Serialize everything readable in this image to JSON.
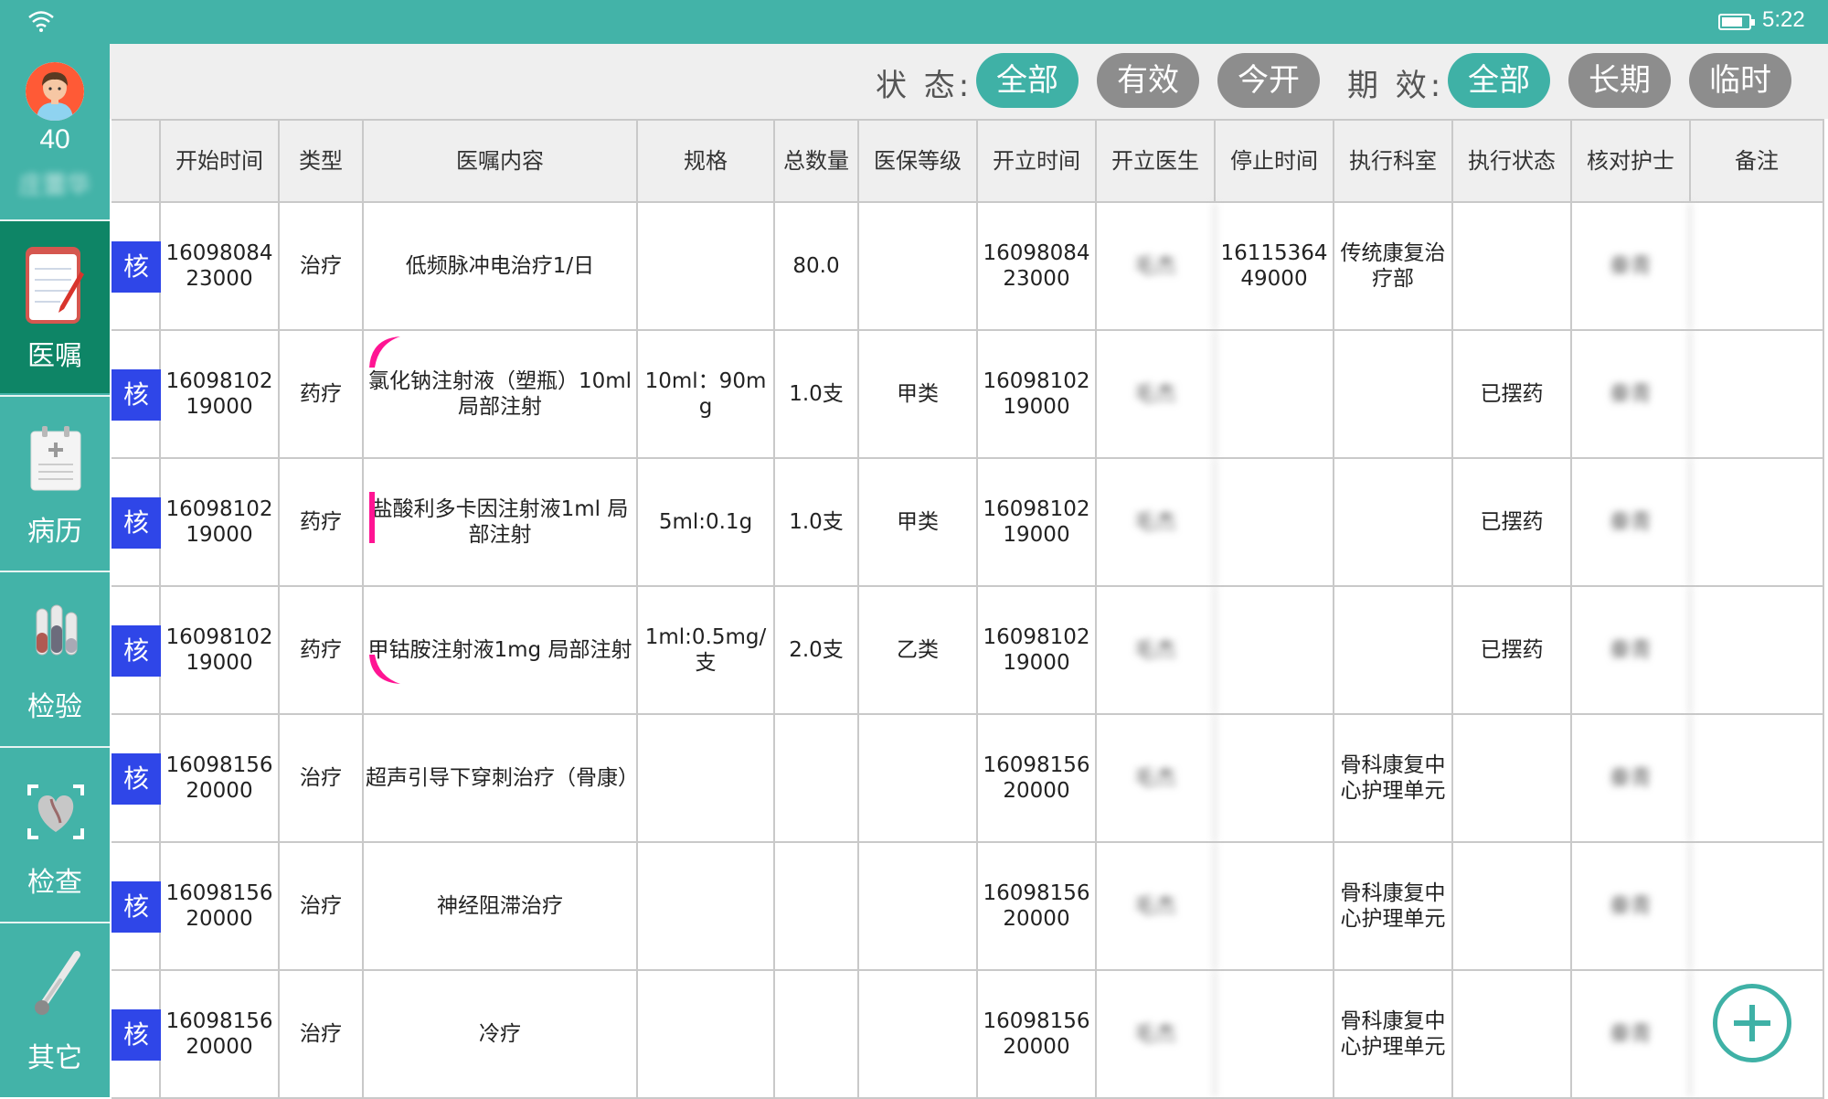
{
  "status_bar": {
    "time": "5:22",
    "battery_level": 0.8,
    "wifi_icon": "wifi-icon",
    "battery_icon": "battery-icon"
  },
  "patient": {
    "bed_number": "40",
    "name": "庄蕾华"
  },
  "sidebar": {
    "items": [
      {
        "label": "医嘱",
        "icon": "notepad-pen-icon",
        "active": true
      },
      {
        "label": "病历",
        "icon": "medical-record-icon",
        "active": false
      },
      {
        "label": "检验",
        "icon": "test-tubes-icon",
        "active": false
      },
      {
        "label": "检查",
        "icon": "heart-scan-icon",
        "active": false
      },
      {
        "label": "其它",
        "icon": "thermometer-icon",
        "active": false
      }
    ]
  },
  "filters": {
    "status_label": "状 态:",
    "status_options": [
      "全部",
      "有效",
      "今开"
    ],
    "status_selected": "全部",
    "period_label": "期 效:",
    "period_options": [
      "全部",
      "长期",
      "临时"
    ],
    "period_selected": "全部"
  },
  "table": {
    "columns": [
      "",
      "开始时间",
      "类型",
      "医嘱内容",
      "规格",
      "总数量",
      "医保等级",
      "开立时间",
      "开立医生",
      "停止时间",
      "执行科室",
      "执行状态",
      "核对护士",
      "备注"
    ],
    "check_label": "核",
    "rows": [
      {
        "start_time": "1609808423000",
        "type": "治疗",
        "content": "低频脉冲电治疗1/日",
        "spec": "",
        "quantity": "80.0",
        "insurance": "",
        "open_time": "1609808423000",
        "doctor": "毛杰",
        "stop_time": "1611536449000",
        "dept": "传统康复治疗部",
        "exec_status": "",
        "nurse": "秦青",
        "note": "",
        "group_mark": ""
      },
      {
        "start_time": "1609810219000",
        "type": "药疗",
        "content": "氯化钠注射液（塑瓶）10ml 局部注射",
        "spec": "10ml：90mg",
        "quantity": "1.0支",
        "insurance": "甲类",
        "open_time": "1609810219000",
        "doctor": "毛杰",
        "stop_time": "",
        "dept": "",
        "exec_status": "已摆药",
        "nurse": "秦青",
        "note": "",
        "group_mark": "start"
      },
      {
        "start_time": "1609810219000",
        "type": "药疗",
        "content": "盐酸利多卡因注射液1ml 局部注射",
        "spec": "5ml:0.1g",
        "quantity": "1.0支",
        "insurance": "甲类",
        "open_time": "1609810219000",
        "doctor": "毛杰",
        "stop_time": "",
        "dept": "",
        "exec_status": "已摆药",
        "nurse": "秦青",
        "note": "",
        "group_mark": "middle"
      },
      {
        "start_time": "1609810219000",
        "type": "药疗",
        "content": "甲钴胺注射液1mg 局部注射",
        "spec": "1ml:0.5mg/支",
        "quantity": "2.0支",
        "insurance": "乙类",
        "open_time": "1609810219000",
        "doctor": "毛杰",
        "stop_time": "",
        "dept": "",
        "exec_status": "已摆药",
        "nurse": "秦青",
        "note": "",
        "group_mark": "end"
      },
      {
        "start_time": "1609815620000",
        "type": "治疗",
        "content": "超声引导下穿刺治疗（骨康）",
        "spec": "",
        "quantity": "",
        "insurance": "",
        "open_time": "1609815620000",
        "doctor": "毛杰",
        "stop_time": "",
        "dept": "骨科康复中心护理单元",
        "exec_status": "",
        "nurse": "秦青",
        "note": "",
        "group_mark": ""
      },
      {
        "start_time": "1609815620000",
        "type": "治疗",
        "content": "神经阻滞治疗",
        "spec": "",
        "quantity": "",
        "insurance": "",
        "open_time": "1609815620000",
        "doctor": "毛杰",
        "stop_time": "",
        "dept": "骨科康复中心护理单元",
        "exec_status": "",
        "nurse": "秦青",
        "note": "",
        "group_mark": ""
      },
      {
        "start_time": "1609815620000",
        "type": "治疗",
        "content": "冷疗",
        "spec": "",
        "quantity": "",
        "insurance": "",
        "open_time": "1609815620000",
        "doctor": "毛杰",
        "stop_time": "",
        "dept": "骨科康复中心护理单元",
        "exec_status": "",
        "nurse": "秦青",
        "note": "",
        "group_mark": ""
      }
    ]
  },
  "colors": {
    "accent": "#43b3a8",
    "active_nav": "#0e8566",
    "check_button": "#2f46e8",
    "group_mark": "#ff1493",
    "pill_inactive": "#8d8d8d"
  },
  "add_button": {
    "icon": "plus-circle-icon"
  }
}
